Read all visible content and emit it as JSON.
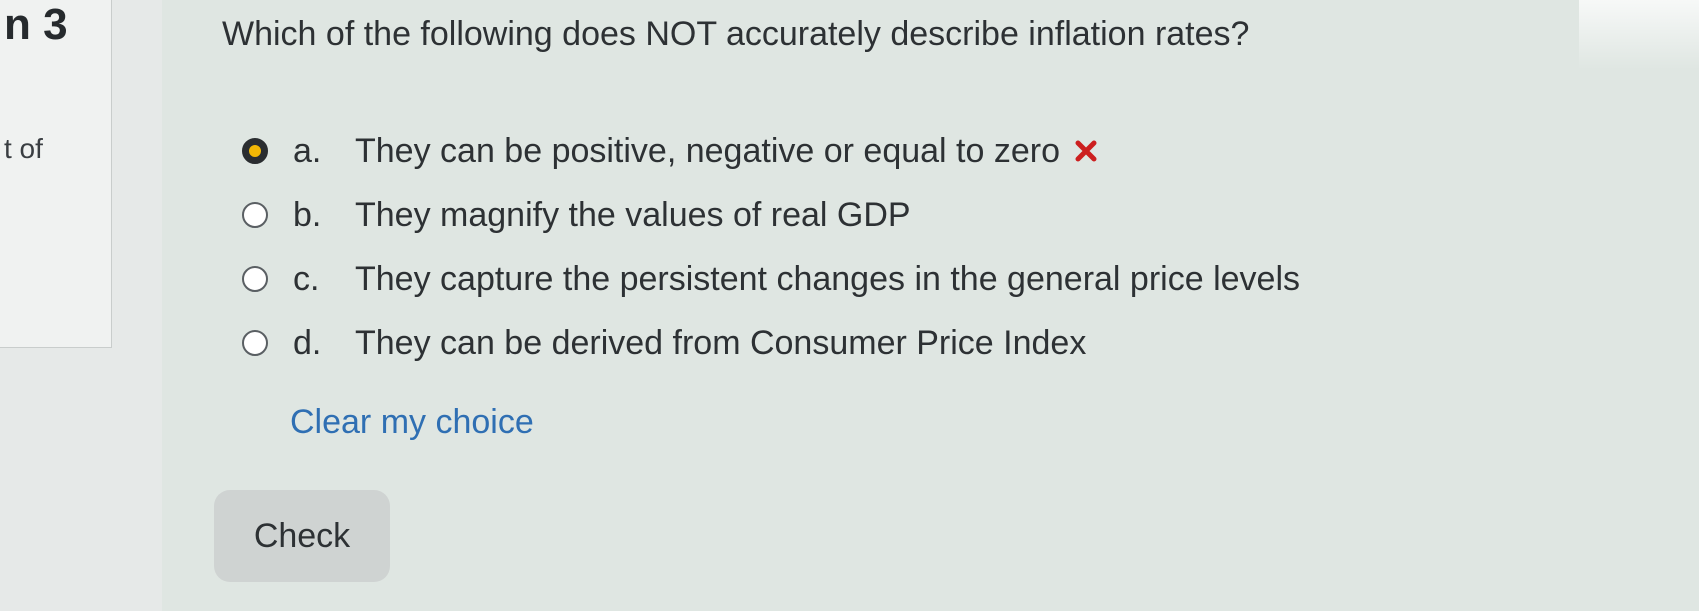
{
  "sidebar": {
    "question_number": "n 3",
    "out_of_fragment": "t of"
  },
  "question": {
    "text": "Which of the following does NOT accurately describe inflation rates?",
    "options": [
      {
        "letter": "a.",
        "text": "They can be positive, negative or equal to zero",
        "selected": true,
        "marked_incorrect": true
      },
      {
        "letter": "b.",
        "text": "They magnify the values of real GDP",
        "selected": false,
        "marked_incorrect": false
      },
      {
        "letter": "c.",
        "text": "They capture the persistent changes in the general price levels",
        "selected": false,
        "marked_incorrect": false
      },
      {
        "letter": "d.",
        "text": "They can be derived from Consumer Price Index",
        "selected": false,
        "marked_incorrect": false
      }
    ],
    "clear_label": "Clear my choice",
    "check_label": "Check"
  },
  "icons": {
    "incorrect": "cross-icon"
  },
  "colors": {
    "selected_radio": "#f2b705",
    "incorrect_mark": "#cc1f1f",
    "link": "#2f6fb3"
  }
}
